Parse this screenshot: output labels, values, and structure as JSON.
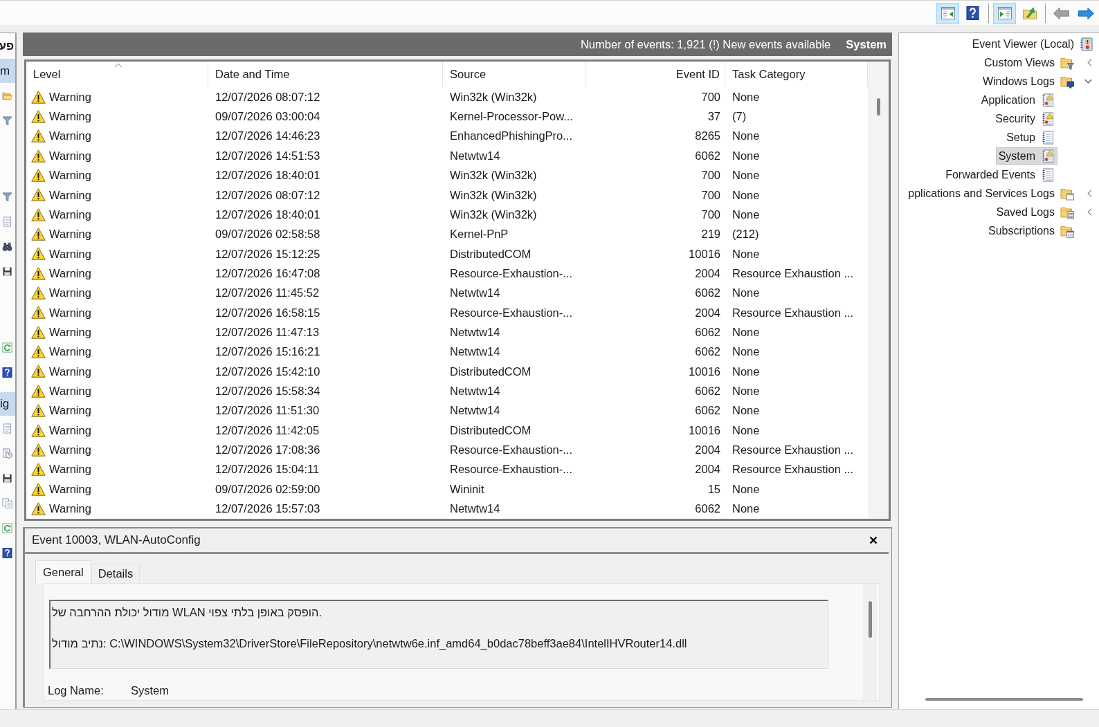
{
  "toolbar": [
    {
      "buttons": [
        {
          "kind": "console-tree",
          "pressed": true,
          "disabled": false
        },
        {
          "kind": "help",
          "pressed": false,
          "disabled": false
        }
      ]
    },
    {
      "buttons": [
        {
          "kind": "action-pane",
          "pressed": true,
          "disabled": false
        },
        {
          "kind": "up-folder",
          "pressed": false,
          "disabled": false
        }
      ]
    },
    {
      "buttons": [
        {
          "kind": "back",
          "pressed": false,
          "disabled": true
        },
        {
          "kind": "forward",
          "pressed": false,
          "disabled": false
        }
      ]
    }
  ],
  "actions_pane": {
    "title": "פע",
    "sections": [
      {
        "title": "m",
        "groups": [
          {
            "actions": [
              {
                "kind": "open-folder"
              },
              {
                "kind": "filter"
              }
            ]
          },
          {
            "actions": [
              {
                "kind": "filter"
              },
              {
                "kind": "document"
              },
              {
                "kind": "binoculars"
              },
              {
                "kind": "disk"
              }
            ]
          },
          {
            "actions": [
              {
                "kind": "refresh"
              },
              {
                "kind": "help"
              }
            ]
          }
        ]
      },
      {
        "title": "ig",
        "groups": [
          {
            "actions": [
              {
                "kind": "document"
              },
              {
                "kind": "clock-document"
              },
              {
                "kind": "disk"
              },
              {
                "kind": "copy"
              },
              {
                "kind": "refresh"
              },
              {
                "kind": "help"
              }
            ]
          }
        ]
      }
    ]
  },
  "events_header": {
    "summary": "Number of events: 1,921 (!) New events available",
    "log": "System"
  },
  "events_table": {
    "columns": [
      {
        "label": "Level",
        "sorted": true
      },
      {
        "label": "Date and Time",
        "sorted": false
      },
      {
        "label": "Source",
        "sorted": false
      },
      {
        "label": "Event ID",
        "sorted": false
      },
      {
        "label": "Task Category",
        "sorted": false
      }
    ],
    "rows": [
      {
        "kind": "warning",
        "cells": [
          "Warning",
          "12/07/2026 08:07:12",
          "Win32k (Win32k)",
          "700",
          "None"
        ]
      },
      {
        "kind": "warning",
        "cells": [
          "Warning",
          "09/07/2026 03:00:04",
          "Kernel-Processor-Pow...",
          "37",
          "(7)"
        ]
      },
      {
        "kind": "warning",
        "cells": [
          "Warning",
          "12/07/2026 14:46:23",
          "EnhancedPhishingPro...",
          "8265",
          "None"
        ]
      },
      {
        "kind": "warning",
        "cells": [
          "Warning",
          "12/07/2026 14:51:53",
          "Netwtw14",
          "6062",
          "None"
        ]
      },
      {
        "kind": "warning",
        "cells": [
          "Warning",
          "12/07/2026 18:40:01",
          "Win32k (Win32k)",
          "700",
          "None"
        ]
      },
      {
        "kind": "warning",
        "cells": [
          "Warning",
          "12/07/2026 08:07:12",
          "Win32k (Win32k)",
          "700",
          "None"
        ]
      },
      {
        "kind": "warning",
        "cells": [
          "Warning",
          "12/07/2026 18:40:01",
          "Win32k (Win32k)",
          "700",
          "None"
        ]
      },
      {
        "kind": "warning",
        "cells": [
          "Warning",
          "09/07/2026 02:58:58",
          "Kernel-PnP",
          "219",
          "(212)"
        ]
      },
      {
        "kind": "warning",
        "cells": [
          "Warning",
          "12/07/2026 15:12:25",
          "DistributedCOM",
          "10016",
          "None"
        ]
      },
      {
        "kind": "warning",
        "cells": [
          "Warning",
          "12/07/2026 16:47:08",
          "Resource-Exhaustion-...",
          "2004",
          "Resource Exhaustion ..."
        ]
      },
      {
        "kind": "warning",
        "cells": [
          "Warning",
          "12/07/2026 11:45:52",
          "Netwtw14",
          "6062",
          "None"
        ]
      },
      {
        "kind": "warning",
        "cells": [
          "Warning",
          "12/07/2026 16:58:15",
          "Resource-Exhaustion-...",
          "2004",
          "Resource Exhaustion ..."
        ]
      },
      {
        "kind": "warning",
        "cells": [
          "Warning",
          "12/07/2026 11:47:13",
          "Netwtw14",
          "6062",
          "None"
        ]
      },
      {
        "kind": "warning",
        "cells": [
          "Warning",
          "12/07/2026 15:16:21",
          "Netwtw14",
          "6062",
          "None"
        ]
      },
      {
        "kind": "warning",
        "cells": [
          "Warning",
          "12/07/2026 15:42:10",
          "DistributedCOM",
          "10016",
          "None"
        ]
      },
      {
        "kind": "warning",
        "cells": [
          "Warning",
          "12/07/2026 15:58:34",
          "Netwtw14",
          "6062",
          "None"
        ]
      },
      {
        "kind": "warning",
        "cells": [
          "Warning",
          "12/07/2026 11:51:30",
          "Netwtw14",
          "6062",
          "None"
        ]
      },
      {
        "kind": "warning",
        "cells": [
          "Warning",
          "12/07/2026 11:42:05",
          "DistributedCOM",
          "10016",
          "None"
        ]
      },
      {
        "kind": "warning",
        "cells": [
          "Warning",
          "12/07/2026 17:08:36",
          "Resource-Exhaustion-...",
          "2004",
          "Resource Exhaustion ..."
        ]
      },
      {
        "kind": "warning",
        "cells": [
          "Warning",
          "12/07/2026 15:04:11",
          "Resource-Exhaustion-...",
          "2004",
          "Resource Exhaustion ..."
        ]
      },
      {
        "kind": "warning",
        "cells": [
          "Warning",
          "09/07/2026 02:59:00",
          "Wininit",
          "15",
          "None"
        ]
      },
      {
        "kind": "warning",
        "cells": [
          "Warning",
          "12/07/2026 15:57:03",
          "Netwtw14",
          "6062",
          "None"
        ]
      }
    ]
  },
  "event_details": {
    "title": "Event 10003, WLAN-AutoConfig",
    "tabs": [
      {
        "label": "General",
        "selected": true
      },
      {
        "label": "Details",
        "selected": false
      }
    ],
    "message": [
      "מודול יכולת ההרחבה של WLAN הופסק באופן בלתי צפוי.",
      "נתיב מודול: C:\\WINDOWS\\System32\\DriverStore\\FileRepository\\netwtw6e.inf_amd64_b0dac78beff3ae84\\IntelIHVRouter14.dll"
    ],
    "fields": [
      {
        "label": "Log Name:",
        "value": "System"
      }
    ]
  },
  "tree": [
    {
      "label": "Event Viewer (Local)",
      "kind": "log-book",
      "selected": false,
      "children": [
        {
          "label": "Custom Views",
          "kind": "filter-folder",
          "selected": false,
          "expanded": false
        },
        {
          "label": "Windows Logs",
          "kind": "monitor-folder",
          "selected": false,
          "expanded": true,
          "children": [
            {
              "label": "Application",
              "kind": "warning-log",
              "selected": false
            },
            {
              "label": "Security",
              "kind": "warning-log",
              "selected": false
            },
            {
              "label": "Setup",
              "kind": "plain-log",
              "selected": false
            },
            {
              "label": "System",
              "kind": "warning-log",
              "selected": true
            },
            {
              "label": "Forwarded Events",
              "kind": "plain-log",
              "selected": false
            }
          ]
        },
        {
          "label": "pplications and Services Logs",
          "kind": "window-folder",
          "selected": false,
          "expanded": false
        },
        {
          "label": "Saved Logs",
          "kind": "document-folder",
          "selected": false,
          "expanded": false
        },
        {
          "label": "Subscriptions",
          "kind": "calendar-folder",
          "selected": false
        }
      ]
    }
  ]
}
